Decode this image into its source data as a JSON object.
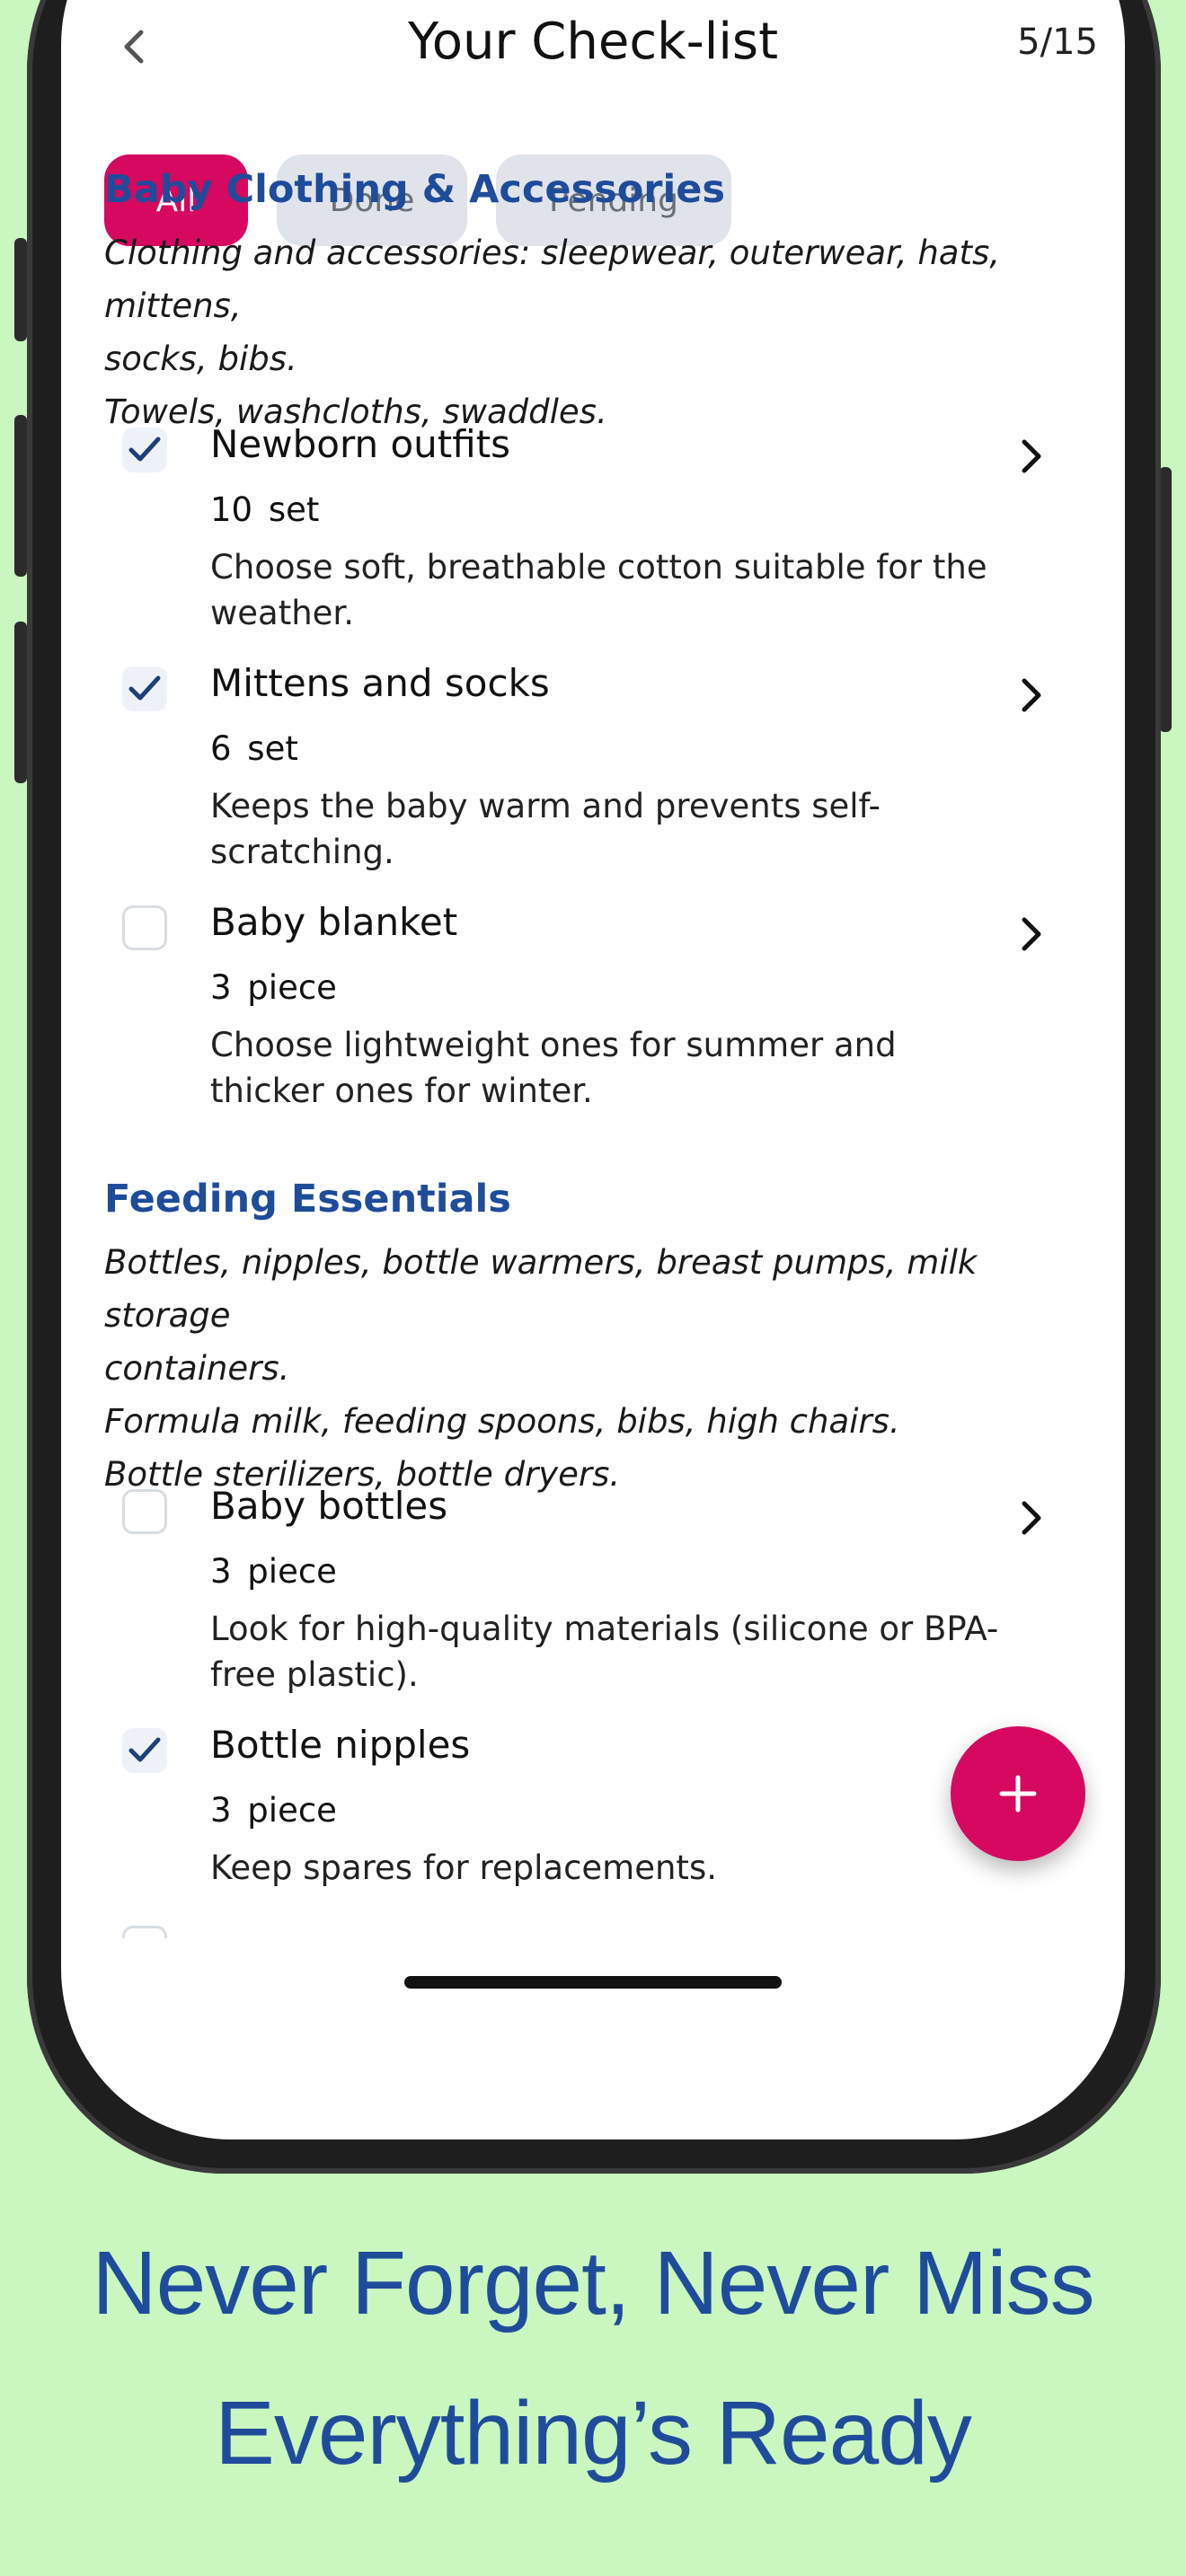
{
  "header": {
    "title": "Your Check-list",
    "progress": "5/15"
  },
  "tabs": [
    {
      "label": "All",
      "active": true
    },
    {
      "label": "Done",
      "active": false
    },
    {
      "label": "Pending",
      "active": false
    }
  ],
  "sections": [
    {
      "title": "Baby Clothing & Accessories",
      "description": [
        "Clothing and accessories: sleepwear, outerwear, hats, mittens,",
        "socks, bibs.",
        "Towels, washcloths, swaddles."
      ],
      "items": [
        {
          "name": "Newborn outfits",
          "quantity": "10 set",
          "note": "Choose soft, breathable cotton suitable for the weather.",
          "checked": true
        },
        {
          "name": "Mittens and socks",
          "quantity": "6 set",
          "note": "Keeps the baby warm and prevents self-scratching.",
          "checked": true
        },
        {
          "name": "Baby blanket",
          "quantity": "3 piece",
          "note": "Choose lightweight ones for summer and thicker ones for winter.",
          "checked": false
        }
      ]
    },
    {
      "title": "Feeding Essentials",
      "description": [
        "Bottles, nipples, bottle warmers, breast pumps, milk storage",
        "containers.",
        "Formula milk, feeding spoons, bibs, high chairs.",
        "Bottle sterilizers, bottle dryers."
      ],
      "items": [
        {
          "name": "Baby bottles",
          "quantity": "3 piece",
          "note": "Look for high-quality materials (silicone or BPA-free plastic).",
          "checked": false
        },
        {
          "name": "Bottle nipples",
          "quantity": "3 piece",
          "note": "Keep spares for replacements.",
          "checked": true
        }
      ]
    }
  ],
  "captions": {
    "line1": "Never Forget, Never Miss",
    "line2": "Everything’s Ready"
  },
  "colors": {
    "background": "#c9f7bf",
    "accent": "#d6085f",
    "heading": "#1f4c9a",
    "checkmark": "#1f3f7a"
  },
  "icons": {
    "back": "chevron-left-icon",
    "item_arrow": "chevron-right-icon",
    "checkbox": "checkmark-icon",
    "fab": "plus-icon"
  }
}
